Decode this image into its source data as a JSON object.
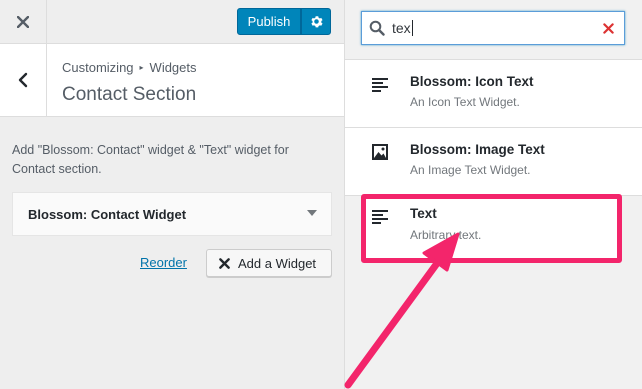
{
  "topbar": {
    "publish_label": "Publish"
  },
  "header": {
    "breadcrumb_root": "Customizing",
    "breadcrumb_current": "Widgets",
    "title": "Contact Section"
  },
  "section": {
    "description": "Add \"Blossom: Contact\" widget & \"Text\" widget for Contact section.",
    "widgets": [
      {
        "name": "Blossom: Contact Widget"
      }
    ],
    "reorder_label": "Reorder",
    "add_widget_label": "Add a Widget"
  },
  "available_widgets": {
    "search_value": "tex",
    "items": [
      {
        "title": "Blossom: Icon Text",
        "description": "An Icon Text Widget.",
        "icon": "text-lines-icon"
      },
      {
        "title": "Blossom: Image Text",
        "description": "An Image Text Widget.",
        "icon": "image-icon"
      },
      {
        "title": "Text",
        "description": "Arbitrary text.",
        "icon": "text-lines-icon",
        "highlighted": true
      }
    ]
  },
  "colors": {
    "accent_blue": "#0085ba",
    "link_blue": "#0073aa",
    "highlight_pink": "#f3256b",
    "clear_red": "#dc3232"
  }
}
